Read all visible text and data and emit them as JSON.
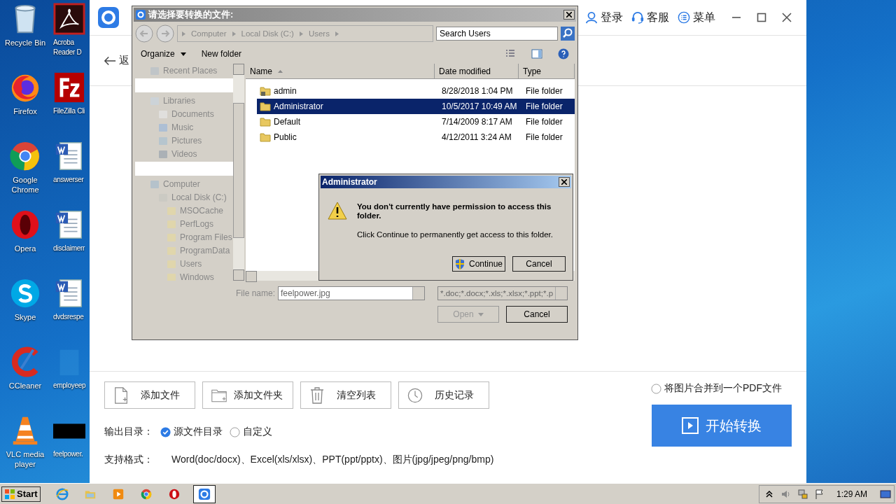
{
  "desktop": {
    "icons": [
      {
        "label": "Recycle Bin",
        "kind": "recycle"
      },
      {
        "label": "Acroba Reader D",
        "kind": "pdf"
      },
      {
        "label": "Firefox",
        "kind": "firefox"
      },
      {
        "label": "FileZilla Cli",
        "kind": "filezilla"
      },
      {
        "label": "Google Chrome",
        "kind": "chrome"
      },
      {
        "label": "answerser",
        "kind": "word"
      },
      {
        "label": "Opera",
        "kind": "opera"
      },
      {
        "label": "disclaimerr",
        "kind": "word"
      },
      {
        "label": "Skype",
        "kind": "skype"
      },
      {
        "label": "dvdsrespe",
        "kind": "word"
      },
      {
        "label": "CCleaner",
        "kind": "ccleaner"
      },
      {
        "label": "employeep",
        "kind": "blank"
      },
      {
        "label": "VLC media player",
        "kind": "vlc"
      },
      {
        "label": "feelpower.",
        "kind": "image"
      }
    ]
  },
  "app": {
    "back": "返",
    "header_actions": [
      {
        "label": "登录",
        "kind": "user"
      },
      {
        "label": "客服",
        "kind": "headset"
      },
      {
        "label": "菜单",
        "kind": "menu"
      }
    ],
    "toolbar_buttons": [
      {
        "label": "添加文件",
        "kind": "file"
      },
      {
        "label": "添加文件夹",
        "kind": "folder"
      },
      {
        "label": "清空列表",
        "kind": "trash"
      },
      {
        "label": "历史记录",
        "kind": "clock"
      }
    ],
    "merge_option": {
      "label": "将图片合并到一个PDF文件",
      "checked": false
    },
    "start_button": "开始转换",
    "output": {
      "label": "输出目录：",
      "options": [
        {
          "label": "源文件目录",
          "selected": true
        },
        {
          "label": "自定义",
          "selected": false
        }
      ]
    },
    "formats": {
      "label": "支持格式：",
      "value": "Word(doc/docx)、Excel(xls/xlsx)、PPT(ppt/pptx)、图片(jpg/jpeg/png/bmp)"
    }
  },
  "file_dialog": {
    "title": "请选择要转换的文件:",
    "breadcrumb": [
      "Computer",
      "Local Disk (C:)",
      "Users"
    ],
    "search": {
      "placeholder": "Search Users"
    },
    "toolbar": {
      "organize": "Organize",
      "new_folder": "New folder"
    },
    "nav_groups": [
      [
        {
          "label": "Recent Places",
          "kind": "recent"
        }
      ],
      [
        {
          "label": "Libraries",
          "kind": "library",
          "children": [
            {
              "label": "Documents",
              "kind": "document"
            },
            {
              "label": "Music",
              "kind": "music"
            },
            {
              "label": "Pictures",
              "kind": "picture"
            },
            {
              "label": "Videos",
              "kind": "video"
            }
          ]
        }
      ],
      [
        {
          "label": "Computer",
          "kind": "computer",
          "children": [
            {
              "label": "Local Disk (C:)",
              "kind": "disk",
              "children": [
                {
                  "label": "MSOCache",
                  "kind": "folder"
                },
                {
                  "label": "PerfLogs",
                  "kind": "folder"
                },
                {
                  "label": "Program Files",
                  "kind": "folder"
                },
                {
                  "label": "ProgramData",
                  "kind": "folder"
                },
                {
                  "label": "Users",
                  "kind": "folder"
                },
                {
                  "label": "Windows",
                  "kind": "folder"
                }
              ]
            }
          ]
        }
      ]
    ],
    "columns": [
      "Name",
      "Date modified",
      "Type"
    ],
    "rows": [
      {
        "name": "admin",
        "date": "8/28/2018 1:04 PM",
        "type": "File folder",
        "selected": false,
        "locked": true
      },
      {
        "name": "Administrator",
        "date": "10/5/2017 10:49 AM",
        "type": "File folder",
        "selected": true,
        "locked": false
      },
      {
        "name": "Default",
        "date": "7/14/2009 8:17 AM",
        "type": "File folder",
        "selected": false,
        "locked": false
      },
      {
        "name": "Public",
        "date": "4/12/2011 3:24 AM",
        "type": "File folder",
        "selected": false,
        "locked": false
      }
    ],
    "file_name_label": "File name:",
    "file_name": "feelpower.jpg",
    "filter": "*.doc;*.docx;*.xls;*.xlsx;*.ppt;*.p",
    "buttons": [
      {
        "label": "Open",
        "disabled": true,
        "split": true
      },
      {
        "label": "Cancel",
        "disabled": false,
        "split": false
      }
    ]
  },
  "permission_dialog": {
    "title": "Administrator",
    "message": "You don't currently have permission to access this folder.",
    "detail": "Click Continue to permanently get access to this folder.",
    "buttons": [
      {
        "label": "Continue",
        "shield": true
      },
      {
        "label": "Cancel",
        "shield": false
      }
    ]
  },
  "taskbar": {
    "start": "Start",
    "apps": [
      {
        "kind": "ie",
        "active": false
      },
      {
        "kind": "explorer",
        "active": false
      },
      {
        "kind": "media",
        "active": false
      },
      {
        "kind": "chrome",
        "active": false
      },
      {
        "kind": "opera",
        "active": false
      },
      {
        "kind": "converter",
        "active": true
      }
    ],
    "time": "1:29 AM"
  }
}
